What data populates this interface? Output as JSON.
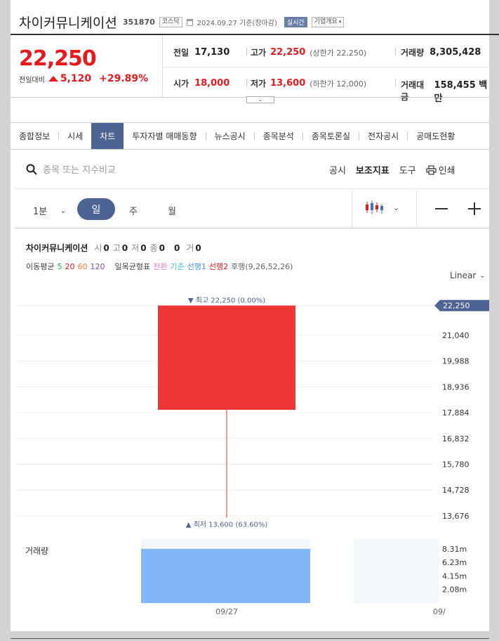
{
  "header": {
    "name": "차이커뮤니케이션",
    "code": "351870",
    "market": "코스닥",
    "date_basis": "2024.09.27 기준(장마감)",
    "realtime": "실시간",
    "company_overview": "기업개요"
  },
  "price": {
    "current": "22,250",
    "change_label": "전일대비",
    "change": "5,120",
    "change_pct": "+29.89%"
  },
  "summary": {
    "prev_label": "전일",
    "prev": "17,130",
    "high_label": "고가",
    "high": "22,250",
    "high_limit": "(상한가 22,250)",
    "volume_label": "거래량",
    "volume": "8,305,428",
    "open_label": "시가",
    "open": "18,000",
    "low_label": "저가",
    "low": "13,600",
    "low_limit": "(하한가 12,000)",
    "amount_label": "거래대금",
    "amount": "158,455 백만"
  },
  "tabs": [
    "종합정보",
    "시세",
    "차트",
    "투자자별 매매동향",
    "뉴스공시",
    "종목분석",
    "종목토론실",
    "전자공시",
    "공매도현황"
  ],
  "toolbar": {
    "search_placeholder": "종목 또는 지수비교",
    "disclosure": "공시",
    "indicators": "보조지표",
    "tools": "도구",
    "print": "인쇄"
  },
  "period": {
    "minute": "1분",
    "day": "일",
    "week": "주",
    "month": "월"
  },
  "legend": {
    "name": "차이커뮤니케이션",
    "o_label": "시",
    "o": "0",
    "h_label": "고",
    "h": "0",
    "l_label": "저",
    "l": "0",
    "c_label": "종",
    "c": "0",
    "chg": "0",
    "v_label": "거",
    "v": "0",
    "ma_label": "이동평균",
    "ma": [
      "5",
      "20",
      "60",
      "120"
    ],
    "ichimoku_label": "일목균형표",
    "ichimoku": [
      "전환",
      "기준",
      "선행1",
      "선행2",
      "후행(9,26,52,26)"
    ]
  },
  "scale_mode": "Linear",
  "colors": {
    "up": "#ef3535",
    "accent": "#4d6394",
    "volume_bar": "#81b6f7",
    "ma5": "#2aa84a",
    "ma20": "#e5191e",
    "ma60": "#f08030",
    "ma120": "#7b4fb8",
    "ich_conv": "#e57bc6",
    "ich_base": "#4dbfd9",
    "ich_span1": "#4a90e2",
    "ich_span2": "#e5191e"
  },
  "chart_data": {
    "type": "candlestick",
    "x": [
      "09/27",
      "09/"
    ],
    "candles": [
      {
        "date": "09/27",
        "open": 18000,
        "high": 22250,
        "low": 13600,
        "close": 22250,
        "volume": 8305428
      }
    ],
    "high_label": "최고 22,250 (0.00%)",
    "low_label": "최저 13,600 (63.60%)",
    "current_price_tag": "22,250",
    "yticks": [
      "21,040",
      "19,988",
      "18,936",
      "17,884",
      "16,832",
      "15,780",
      "14,728",
      "13,676"
    ],
    "ylim": [
      13300,
      22500
    ],
    "volume_label": "거래량",
    "volume_ticks": [
      "8.31m",
      "6.23m",
      "4.15m",
      "2.08m"
    ],
    "volume_ylim": [
      0,
      9800000
    ],
    "xticks": [
      "09/27",
      "09/"
    ]
  }
}
